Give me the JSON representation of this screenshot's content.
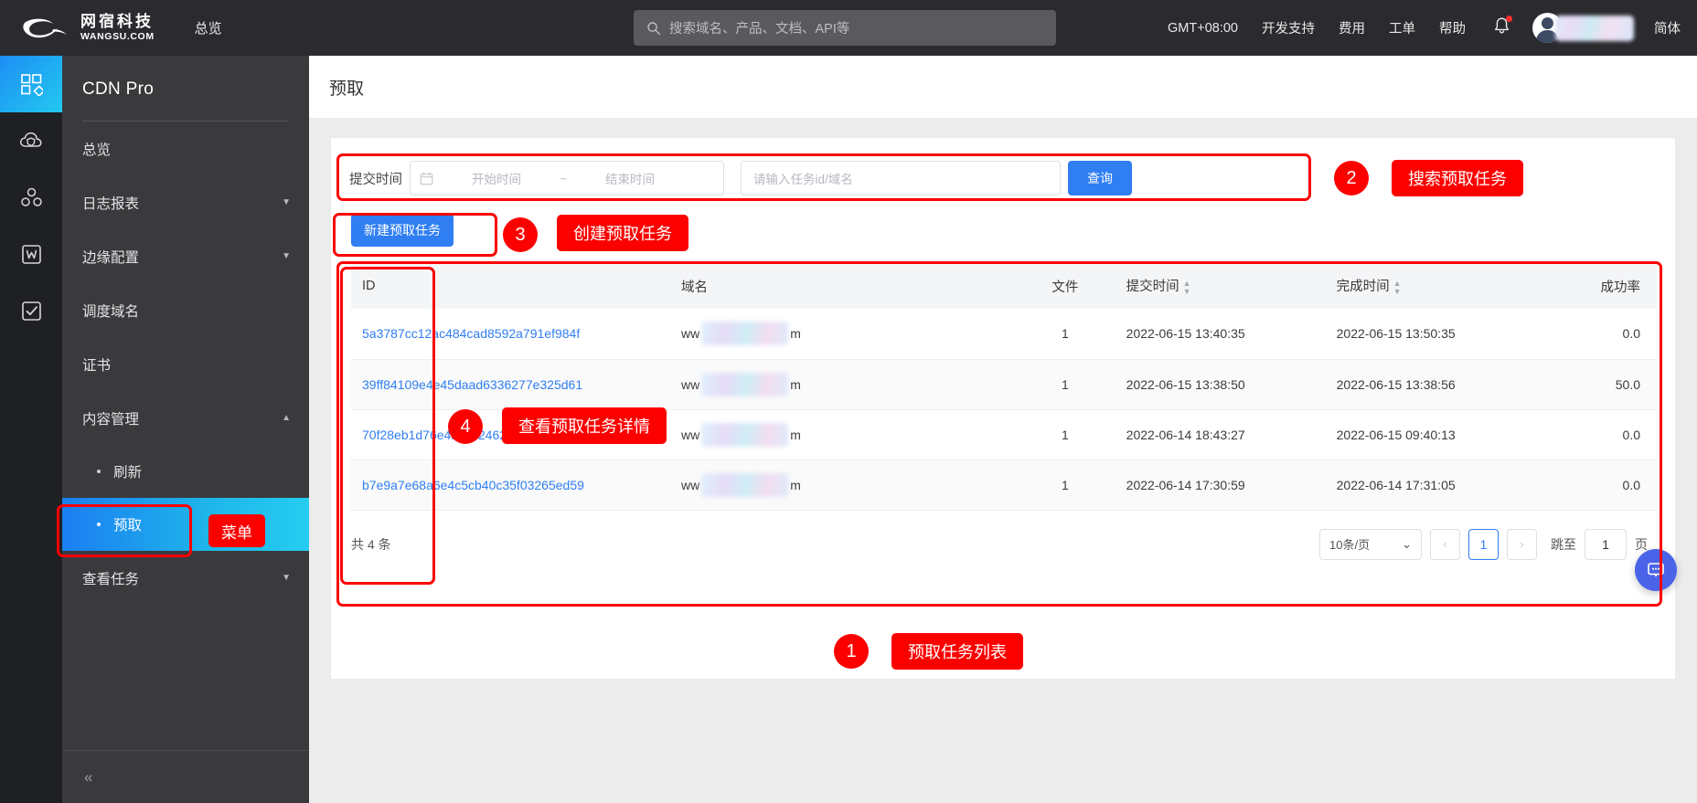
{
  "topbar": {
    "brand_cn": "网宿科技",
    "brand_en": "WANGSU.COM",
    "nav_overview": "总览",
    "search_placeholder": "搜索域名、产品、文档、API等",
    "search_icon": "search-icon",
    "timezone": "GMT+08:00",
    "links": [
      "开发支持",
      "费用",
      "工单",
      "帮助"
    ],
    "bell_icon": "bell-icon",
    "language": "简体"
  },
  "rail": {
    "items": [
      {
        "name": "dashboard-grid-icon",
        "active": true
      },
      {
        "name": "cloud-shield-icon",
        "active": false
      },
      {
        "name": "nodes-icon",
        "active": false
      },
      {
        "name": "w-box-icon",
        "active": false
      },
      {
        "name": "check-box-icon",
        "active": false
      }
    ]
  },
  "sidebar": {
    "title": "CDN Pro",
    "items": [
      {
        "label": "总览",
        "expandable": false
      },
      {
        "label": "日志报表",
        "expandable": true,
        "expanded": false,
        "caret": "▼"
      },
      {
        "label": "边缘配置",
        "expandable": true,
        "expanded": false,
        "caret": "▼"
      },
      {
        "label": "调度域名",
        "expandable": false
      },
      {
        "label": "证书",
        "expandable": false
      },
      {
        "label": "内容管理",
        "expandable": true,
        "expanded": true,
        "caret": "▲"
      }
    ],
    "subitems": [
      {
        "label": "刷新",
        "active": false
      },
      {
        "label": "预取",
        "active": true
      }
    ],
    "after_items": [
      {
        "label": "查看任务",
        "expandable": true,
        "caret": "▼"
      }
    ],
    "collapse_icon": "collapse-chevrons-icon"
  },
  "page": {
    "title": "预取"
  },
  "filter": {
    "time_label": "提交时间",
    "calendar_icon": "calendar-icon",
    "start_placeholder": "开始时间",
    "separator": "~",
    "end_placeholder": "结束时间",
    "keyword_placeholder": "请输入任务id/域名",
    "query_button": "查询",
    "new_task_button": "新建预取任务"
  },
  "table": {
    "columns": [
      {
        "key": "id",
        "label": "ID",
        "sortable": false
      },
      {
        "key": "domain",
        "label": "域名",
        "sortable": false
      },
      {
        "key": "file",
        "label": "文件",
        "sortable": false
      },
      {
        "key": "submit_time",
        "label": "提交时间",
        "sortable": true,
        "sort_icon": "sort-arrows-icon"
      },
      {
        "key": "finish_time",
        "label": "完成时间",
        "sortable": true,
        "sort_icon": "sort-arrows-icon"
      },
      {
        "key": "rate",
        "label": "成功率",
        "sortable": false
      }
    ],
    "rows": [
      {
        "id": "5a3787cc12ac484cad8592a791ef984f",
        "domain_prefix": "ww",
        "domain_suffix": "m",
        "file": "1",
        "submit_time": "2022-06-15 13:40:35",
        "finish_time": "2022-06-15 13:50:35",
        "rate": "0.0"
      },
      {
        "id": "39ff84109e4e45daad6336277e325d61",
        "domain_prefix": "ww",
        "domain_suffix": "m",
        "file": "1",
        "submit_time": "2022-06-15 13:38:50",
        "finish_time": "2022-06-15 13:38:56",
        "rate": "50.0"
      },
      {
        "id": "70f28eb1d76e4bccb2462fdfb0ccdc03",
        "domain_prefix": "ww",
        "domain_suffix": "m",
        "file": "1",
        "submit_time": "2022-06-14 18:43:27",
        "finish_time": "2022-06-15 09:40:13",
        "rate": "0.0"
      },
      {
        "id": "b7e9a7e68a6e4c5cb40c35f03265ed59",
        "domain_prefix": "ww",
        "domain_suffix": "m",
        "file": "1",
        "submit_time": "2022-06-14 17:30:59",
        "finish_time": "2022-06-14 17:31:05",
        "rate": "0.0"
      }
    ]
  },
  "footer": {
    "total_text": "共 4 条",
    "page_size": "10条/页",
    "page_size_caret": "⌄",
    "prev_icon": "‹",
    "current_page": "1",
    "next_icon": "›",
    "jump_label": "跳至",
    "jump_value": "1",
    "jump_unit": "页"
  },
  "fab": {
    "icon": "chat-bubble-icon"
  },
  "annotations": {
    "menu_label": "菜单",
    "items": [
      {
        "num": "1",
        "label": "预取任务列表"
      },
      {
        "num": "2",
        "label": "搜索预取任务"
      },
      {
        "num": "3",
        "label": "创建预取任务"
      },
      {
        "num": "4",
        "label": "查看预取任务详情"
      }
    ]
  },
  "colors": {
    "accent_blue": "#2f7ef2",
    "annotation_red": "#fc0000",
    "topbar_bg": "#2b2b2f",
    "sidemenu_bg": "#3a3a3d",
    "rail_bg": "#1f2023",
    "page_bg": "#ececec"
  }
}
